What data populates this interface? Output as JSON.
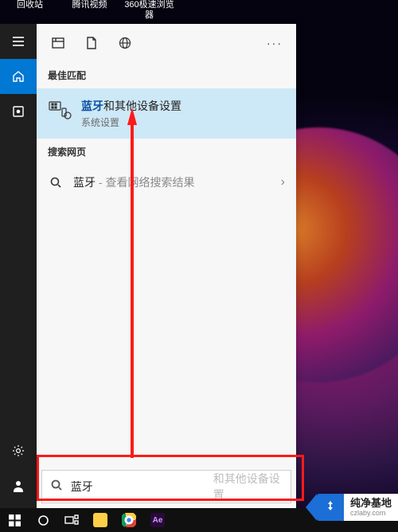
{
  "desktop": {
    "icons": [
      "回收站",
      "腾讯视频",
      "360极速浏览器"
    ]
  },
  "rail": {
    "top": [
      {
        "name": "hamburger"
      },
      {
        "name": "home",
        "selected": true
      },
      {
        "name": "clock-box"
      }
    ],
    "bottom": [
      {
        "name": "settings-gear"
      },
      {
        "name": "user-account"
      }
    ]
  },
  "panel": {
    "header_tabs": [
      "apps-tab",
      "documents-tab",
      "web-tab"
    ],
    "section_best": "最佳匹配",
    "best_match": {
      "keyword": "蓝牙",
      "rest": "和其他设备设置",
      "sub": "系统设置"
    },
    "section_web": "搜索网页",
    "web_row": {
      "keyword": "蓝牙",
      "hint": " - 查看网络搜索结果"
    },
    "search": {
      "value": "蓝牙",
      "placeholder": "和其他设备设置"
    }
  },
  "taskbar": {
    "items": [
      {
        "name": "start-button"
      },
      {
        "name": "cortana-button"
      },
      {
        "name": "task-view-button"
      },
      {
        "name": "file-explorer"
      },
      {
        "name": "chrome"
      },
      {
        "name": "after-effects"
      }
    ]
  },
  "watermark": {
    "title": "纯净基地",
    "sub": "czlaby.com"
  },
  "colors": {
    "accent": "#0078d4",
    "highlight": "#cde8f6",
    "annotation": "#ff1a1a"
  }
}
